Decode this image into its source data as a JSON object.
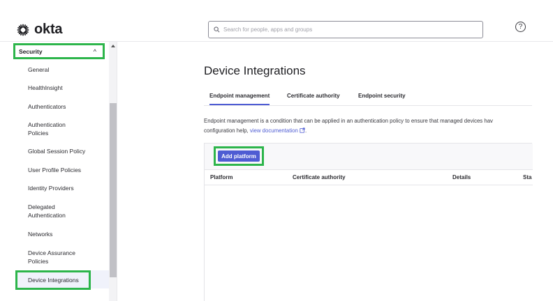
{
  "header": {
    "logo_text": "okta",
    "search_placeholder": "Search for people, apps and groups",
    "help_symbol": "?"
  },
  "sidebar": {
    "section": "Security",
    "section_chevron": "^",
    "items": [
      {
        "label": "General"
      },
      {
        "label": "HealthInsight"
      },
      {
        "label": "Authenticators"
      },
      {
        "label": "Authentication Policies"
      },
      {
        "label": "Global Session Policy"
      },
      {
        "label": "User Profile Policies"
      },
      {
        "label": "Identity Providers"
      },
      {
        "label": "Delegated Authentication"
      },
      {
        "label": "Networks"
      },
      {
        "label": "Device Assurance Policies"
      },
      {
        "label": "Device Integrations"
      }
    ],
    "active_item": "Device Integrations"
  },
  "main": {
    "title": "Device Integrations",
    "tabs": [
      {
        "label": "Endpoint management",
        "active": true
      },
      {
        "label": "Certificate authority",
        "active": false
      },
      {
        "label": "Endpoint security",
        "active": false
      }
    ],
    "description_line1": "Endpoint management is a condition that can be applied in an authentication policy to ensure that managed devices hav",
    "description_line2": "configuration help,",
    "doc_link": "view documentation",
    "doc_link_suffix": ".",
    "add_button": "Add platform",
    "columns": [
      "Platform",
      "Certificate authority",
      "Details",
      "Sta"
    ]
  },
  "colors": {
    "accent": "#4e5cd3",
    "highlight": "#2db54b"
  }
}
